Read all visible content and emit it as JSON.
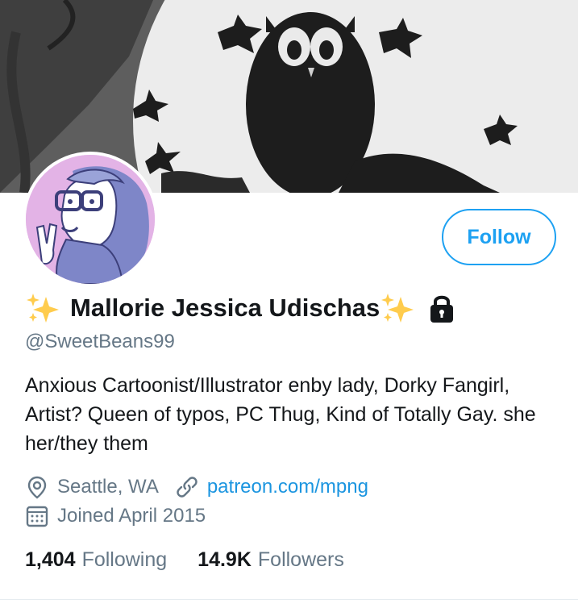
{
  "profile": {
    "display_name": "Mallorie Jessica Udischas",
    "handle": "@SweetBeans99",
    "bio": "Anxious Cartoonist/Illustrator enby lady, Dorky Fangirl, Artist? Queen of typos, PC Thug, Kind of Totally Gay. she her/they them",
    "location": "Seattle, WA",
    "website": "patreon.com/mpng",
    "joined": "Joined April 2015",
    "protected": true
  },
  "actions": {
    "follow_label": "Follow"
  },
  "stats": {
    "following_count": "1,404",
    "following_label": "Following",
    "followers_count": "14.9K",
    "followers_label": "Followers"
  },
  "icons": {
    "sparkle": "sparkles-icon",
    "lock": "lock-icon",
    "location": "location-pin-icon",
    "link": "link-icon",
    "calendar": "calendar-icon"
  },
  "colors": {
    "accent": "#1da1f2",
    "link": "#1b95e0",
    "muted": "#657786",
    "sparkle": "#ffcc4d"
  }
}
